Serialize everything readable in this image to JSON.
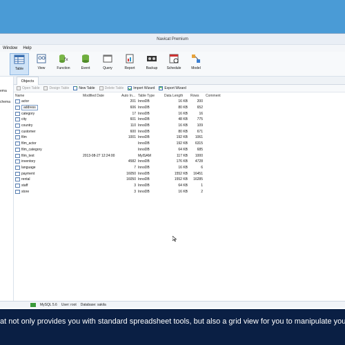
{
  "window": {
    "title": "Navicat Premium"
  },
  "menubar": {
    "items": [
      "Window",
      "Help"
    ]
  },
  "toolbar": {
    "items": [
      {
        "label": "Table",
        "icon": "table-icon",
        "active": true
      },
      {
        "label": "View",
        "icon": "view-icon"
      },
      {
        "label": "Function",
        "icon": "function-icon"
      },
      {
        "label": "Event",
        "icon": "event-icon"
      },
      {
        "label": "Query",
        "icon": "query-icon"
      },
      {
        "label": "Report",
        "icon": "report-icon"
      },
      {
        "label": "Backup",
        "icon": "backup-icon"
      },
      {
        "label": "Schedule",
        "icon": "schedule-icon"
      },
      {
        "label": "Model",
        "icon": "model-icon"
      }
    ]
  },
  "left_pane": {
    "items": [
      "ema",
      "chema"
    ]
  },
  "objects_tab": {
    "label": "Objects"
  },
  "subbar": {
    "open_table": "Open Table",
    "design_table": "Design Table",
    "new_table": "New Table",
    "delete_table": "Delete Table",
    "import_wizard": "Import Wizard",
    "export_wizard": "Export Wizard"
  },
  "table": {
    "headers": [
      "Name",
      "Modified Date",
      "Auto In...",
      "Table Type",
      "Data Length",
      "Rows",
      "Comment"
    ],
    "rows": [
      [
        "actor",
        "",
        "201",
        "InnoDB",
        "16 KB",
        "200",
        ""
      ],
      [
        "address",
        "",
        "606",
        "InnoDB",
        "80 KB",
        "652",
        ""
      ],
      [
        "category",
        "",
        "17",
        "InnoDB",
        "16 KB",
        "16",
        ""
      ],
      [
        "city",
        "",
        "601",
        "InnoDB",
        "48 KB",
        "775",
        ""
      ],
      [
        "country",
        "",
        "110",
        "InnoDB",
        "16 KB",
        "109",
        ""
      ],
      [
        "customer",
        "",
        "600",
        "InnoDB",
        "80 KB",
        "671",
        ""
      ],
      [
        "film",
        "",
        "1001",
        "InnoDB",
        "192 KB",
        "1061",
        ""
      ],
      [
        "film_actor",
        "",
        "",
        "InnoDB",
        "192 KB",
        "6315",
        ""
      ],
      [
        "film_category",
        "",
        "",
        "InnoDB",
        "64 KB",
        "685",
        ""
      ],
      [
        "film_text",
        "2013-08-27 12:24:00",
        "",
        "MyISAM",
        "117 KB",
        "1000",
        ""
      ],
      [
        "inventory",
        "",
        "4582",
        "InnoDB",
        "176 KB",
        "4728",
        ""
      ],
      [
        "language",
        "",
        "7",
        "InnoDB",
        "16 KB",
        "6",
        ""
      ],
      [
        "payment",
        "",
        "16050",
        "InnoDB",
        "1552 KB",
        "16451",
        ""
      ],
      [
        "rental",
        "",
        "16050",
        "InnoDB",
        "1552 KB",
        "16285",
        ""
      ],
      [
        "staff",
        "",
        "3",
        "InnoDB",
        "64 KB",
        "1",
        ""
      ],
      [
        "store",
        "",
        "3",
        "InnoDB",
        "16 KB",
        "2",
        ""
      ]
    ],
    "selected_row": 1
  },
  "statusbar": {
    "server": "MySQL 5.6",
    "user": "User: root",
    "database": "Database: sakila"
  },
  "caption": {
    "text": "at not only provides you with standard spreadsheet tools, but also a grid view for you to manipulate you"
  },
  "colors": {
    "desktop": "#4a9bd6",
    "caption_bg": "#0a1f44",
    "active_tool": "#cfe3f7"
  }
}
